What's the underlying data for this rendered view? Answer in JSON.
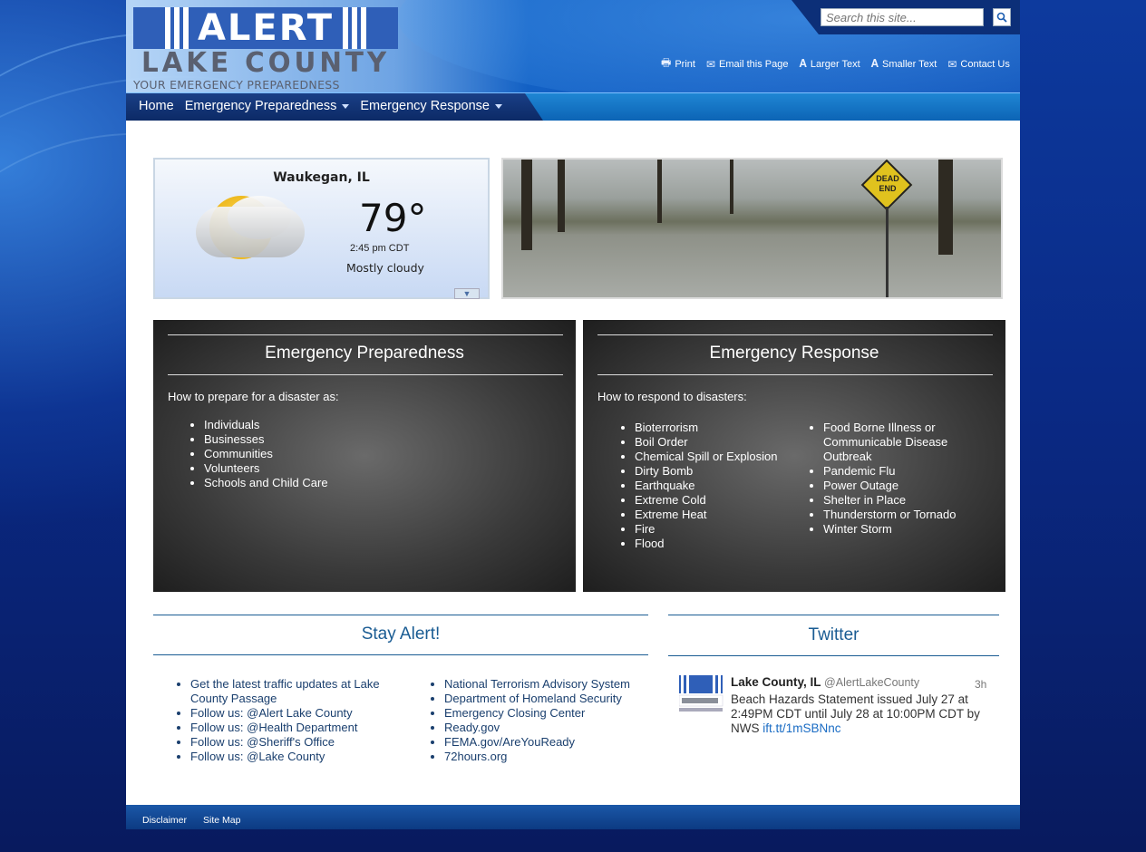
{
  "header": {
    "logo_word": "ALERT",
    "logo_title": "LAKE COUNTY",
    "logo_tagline": "YOUR EMERGENCY PREPAREDNESS RESOURCE",
    "search_placeholder": "Search this site...",
    "utilities": [
      {
        "label": "Print",
        "icon": "printer-icon"
      },
      {
        "label": "Email this Page",
        "icon": "email-icon"
      },
      {
        "label": "Larger Text",
        "icon": "larger-text-icon"
      },
      {
        "label": "Smaller Text",
        "icon": "smaller-text-icon"
      },
      {
        "label": "Contact Us",
        "icon": "envelope-icon"
      }
    ]
  },
  "nav": {
    "items": [
      {
        "label": "Home",
        "dropdown": false
      },
      {
        "label": "Emergency Preparedness",
        "dropdown": true
      },
      {
        "label": "Emergency Response",
        "dropdown": true
      }
    ]
  },
  "weather": {
    "city": "Waukegan, IL",
    "temp": "79°",
    "time": "2:45 pm CDT",
    "condition": "Mostly cloudy",
    "icon": "partly-cloudy-icon"
  },
  "flood_image": {
    "sign_text": "DEAD END"
  },
  "preparedness": {
    "title": "Emergency Preparedness",
    "intro": "How to prepare for a disaster as:",
    "items": [
      "Individuals",
      "Businesses",
      "Communities",
      "Volunteers",
      "Schools and Child Care"
    ]
  },
  "response": {
    "title": "Emergency Response",
    "intro": "How to respond to disasters:",
    "col1": [
      "Bioterrorism",
      "Boil Order",
      "Chemical Spill or Explosion",
      "Dirty Bomb",
      "Earthquake",
      "Extreme Cold",
      "Extreme Heat",
      "Fire",
      "Flood"
    ],
    "col2": [
      "Food Borne Illness or Communicable Disease Outbreak",
      "Pandemic Flu",
      "Power Outage",
      "Shelter in Place",
      "Thunderstorm or Tornado",
      "Winter Storm"
    ]
  },
  "stay_alert": {
    "title": "Stay Alert!",
    "col1": [
      "Get the latest traffic updates at Lake County Passage",
      "Follow us: @Alert Lake County",
      "Follow us: @Health Department",
      "Follow us: @Sheriff's Office",
      "Follow us: @Lake County"
    ],
    "col2": [
      "National Terrorism Advisory System",
      "Department of Homeland Security",
      "Emergency Closing Center",
      "Ready.gov",
      "FEMA.gov/AreYouReady",
      "72hours.org"
    ]
  },
  "twitter": {
    "title": "Twitter",
    "name": "Lake County, IL",
    "handle": "@AlertLakeCounty",
    "time": "3h",
    "text": "Beach Hazards Statement issued July 27 at 2:49PM CDT until July 28 at 10:00PM CDT by NWS ",
    "link": "ift.tt/1mSBNnc"
  },
  "footer": {
    "links": [
      "Disclaimer",
      "Site Map"
    ]
  },
  "colors": {
    "background": "#0a1f6b",
    "accent": "#1a5c93",
    "nav": "#0c64b5"
  }
}
